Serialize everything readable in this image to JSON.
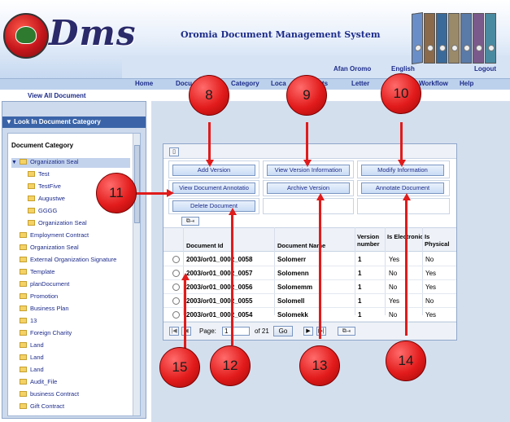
{
  "header": {
    "logo_text": "Dms",
    "app_title": "Oromia Document Management System",
    "lang_links": [
      "Afan Oromo",
      "English"
    ],
    "logout": "Logout"
  },
  "nav": {
    "items": [
      "Home",
      "Docu",
      "Category",
      "Loca",
      "ts",
      "Letter",
      "Workflow",
      "Help"
    ]
  },
  "subnav": {
    "label": "View All Document"
  },
  "sidebar": {
    "header": "Look In Document Category",
    "title": "Document Category",
    "items": [
      "Organization Seal",
      "Test",
      "TestFive",
      "Augustwe",
      "GGGG",
      "Organization Seal",
      "Employment Contract",
      "Organization Seal",
      "External Organization Signature",
      "Template",
      "planDocument",
      "Promotion",
      "Business Plan",
      "13",
      "Foreign Charity",
      "Land",
      "Land",
      "Land",
      "Audit_File",
      "business Contract",
      "Gift Contract"
    ]
  },
  "actions": {
    "add_version": "Add Version",
    "view_version_info": "View Version Information",
    "modify_info": "Modify Information",
    "view_annotation": "View Document Annotatio",
    "archive_version": "Archive Version",
    "annotate": "Annotate Document",
    "delete": "Delete Document"
  },
  "table": {
    "headers": {
      "doc_id": "Document Id",
      "doc_name": "Document Name",
      "version": "Version number",
      "electronic": "Is Electronic",
      "physical": "Is Physical"
    },
    "rows": [
      {
        "id": "2003/or01_0002_0058",
        "name": "Solomerr",
        "version": "1",
        "electronic": "Yes",
        "physical": "No"
      },
      {
        "id": "2003/or01_0002_0057",
        "name": "Solomenn",
        "version": "1",
        "electronic": "No",
        "physical": "Yes"
      },
      {
        "id": "2003/or01_0002_0056",
        "name": "Solomemm",
        "version": "1",
        "electronic": "No",
        "physical": "Yes"
      },
      {
        "id": "2003/or01_0002_0055",
        "name": "Solomell",
        "version": "1",
        "electronic": "Yes",
        "physical": "No"
      },
      {
        "id": "2003/or01_0002_0054",
        "name": "Solomekk",
        "version": "1",
        "electronic": "No",
        "physical": "Yes"
      }
    ]
  },
  "pager": {
    "page_label": "Page:",
    "page_value": "1",
    "of_total": "of 21",
    "go": "Go"
  },
  "callouts": [
    "8",
    "9",
    "10",
    "11",
    "12",
    "13",
    "14",
    "15"
  ],
  "colors": {
    "accent": "#1d2c8a",
    "callout": "#e21b1b",
    "sidebar_header": "#3b64a8",
    "binder_colors": [
      "#6a8fc8",
      "#8a6a4a",
      "#3a6a9a",
      "#9a8a6a",
      "#5a7aa8",
      "#7a5a8a",
      "#4a8aa0"
    ]
  }
}
